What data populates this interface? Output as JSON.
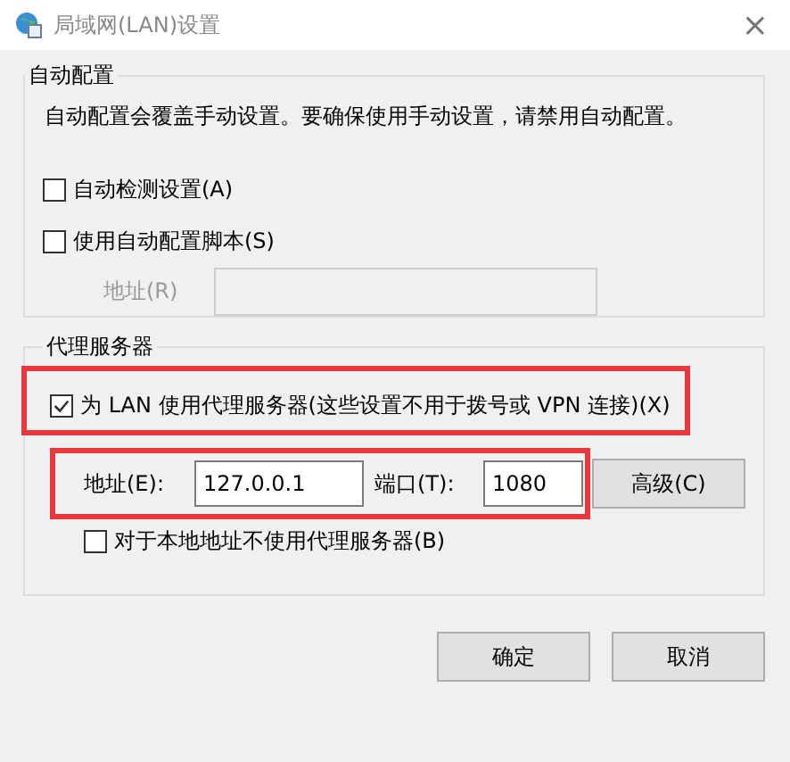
{
  "window": {
    "title": "局域网(LAN)设置",
    "close": "×"
  },
  "auto_config": {
    "title": "自动配置",
    "description": "自动配置会覆盖手动设置。要确保使用手动设置，请禁用自动配置。",
    "options": [
      {
        "label": "自动检测设置(A)",
        "checked": false
      },
      {
        "label": "使用自动配置脚本(S)",
        "checked": false
      }
    ],
    "address": {
      "label": "地址(R)",
      "disabled": true
    }
  },
  "proxy": {
    "title": "代理服务器",
    "use_proxy": {
      "label": "为 LAN 使用代理服务器(这些设置不用于拨号或 VPN 连接)(X)",
      "checked": true,
      "highlighted": true
    },
    "address_row": {
      "highlighted": true,
      "address_label": "地址(E):",
      "address_value": "127.0.0.1",
      "port_label": "端口(T):",
      "port_value": "1080"
    },
    "advanced_button": "高级(C)",
    "bypass_local": {
      "label": "对于本地地址不使用代理服务器(B)",
      "checked": false
    }
  },
  "buttons": [
    "确定",
    "取消"
  ]
}
